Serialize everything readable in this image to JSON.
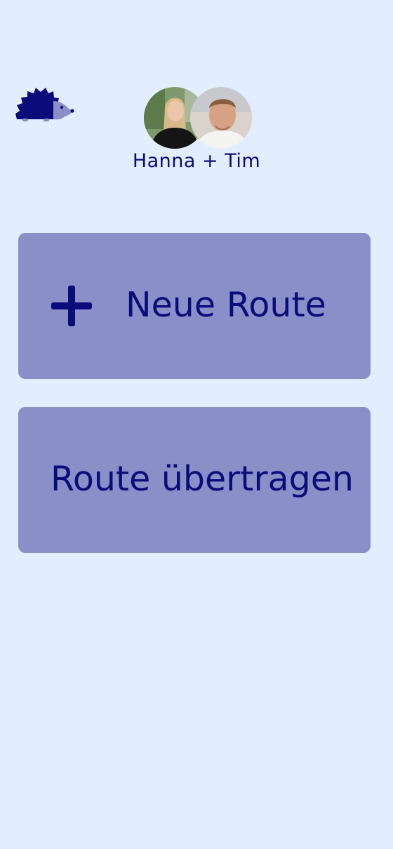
{
  "header": {
    "logo_icon": "hedgehog-icon",
    "users": [
      {
        "name": "Hanna",
        "avatar": "avatar-hanna"
      },
      {
        "name": "Tim",
        "avatar": "avatar-tim"
      }
    ],
    "users_label": "Hanna + Tim"
  },
  "actions": {
    "new_route": {
      "label": "Neue Route",
      "icon": "plus-icon"
    },
    "transfer_route": {
      "label": "Route übertragen"
    }
  },
  "colors": {
    "background": "#E2EEFE",
    "card": "#8A8FC8",
    "accent": "#0B0B7A"
  }
}
